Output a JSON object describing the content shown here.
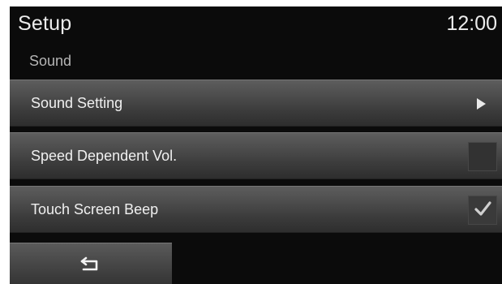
{
  "header": {
    "title": "Setup",
    "clock": "12:00"
  },
  "section": {
    "label": "Sound"
  },
  "menu": {
    "items": [
      {
        "label": "Sound Setting",
        "control": "arrow-right-icon"
      },
      {
        "label": "Speed Dependent Vol.",
        "control": "checkbox",
        "checked": false
      },
      {
        "label": "Touch Screen Beep",
        "control": "checkbox",
        "checked": true
      }
    ]
  },
  "footer": {
    "back_icon": "back-arrow-icon"
  },
  "colors": {
    "screen_background": "#0b0b0b",
    "row_gradient_top": "#5d5d5d",
    "row_gradient_bottom": "#2e2e2e",
    "text_primary": "#f0f0f0",
    "text_secondary": "#b5b5b5"
  }
}
